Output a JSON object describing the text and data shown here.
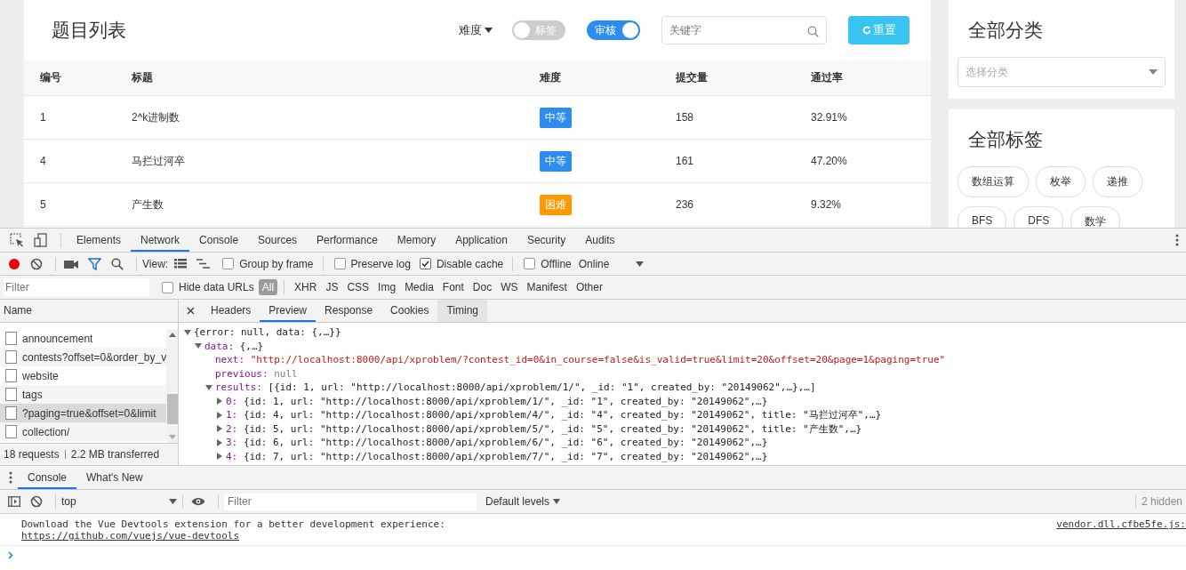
{
  "app": {
    "title": "题目列表",
    "difficulty_filter": "难度",
    "toggles": [
      {
        "label": "标签",
        "on": false
      },
      {
        "label": "审核",
        "on": true
      }
    ],
    "search": {
      "placeholder": "关键字"
    },
    "reset_button": "重置",
    "table": {
      "columns": [
        "编号",
        "标题",
        "难度",
        "提交量",
        "通过率"
      ],
      "rows": [
        {
          "id": "1",
          "title": "2^k进制数",
          "difficulty": "中等",
          "color": "#2d8cf0",
          "submissions": "158",
          "rate": "32.91%"
        },
        {
          "id": "4",
          "title": "马拦过河卒",
          "difficulty": "中等",
          "color": "#2d8cf0",
          "submissions": "161",
          "rate": "47.20%"
        },
        {
          "id": "5",
          "title": "产生数",
          "difficulty": "困难",
          "color": "#ff9900",
          "submissions": "236",
          "rate": "9.32%"
        }
      ]
    },
    "sidebar": {
      "category_title": "全部分类",
      "category_select": {
        "placeholder": "选择分类"
      },
      "tags_title": "全部标签",
      "tags": [
        "数组运算",
        "枚举",
        "递推",
        "BFS",
        "DFS",
        "数学"
      ]
    }
  },
  "devtools": {
    "tabs": [
      {
        "label": "Elements",
        "selected": false
      },
      {
        "label": "Network",
        "selected": true
      },
      {
        "label": "Console",
        "selected": false
      },
      {
        "label": "Sources",
        "selected": false
      },
      {
        "label": "Performance",
        "selected": false
      },
      {
        "label": "Memory",
        "selected": false
      },
      {
        "label": "Application",
        "selected": false
      },
      {
        "label": "Security",
        "selected": false
      },
      {
        "label": "Audits",
        "selected": false
      }
    ],
    "toolbar": {
      "view_label": "View:",
      "options": [
        {
          "label": "Group by frame",
          "checked": false
        },
        {
          "label": "Preserve log",
          "checked": false
        },
        {
          "label": "Disable cache",
          "checked": true
        },
        {
          "label": "Offline",
          "checked": false
        }
      ],
      "throttle": "Online"
    },
    "filter": {
      "placeholder": "Filter",
      "hide_data_urls": {
        "label": "Hide data URLs",
        "checked": false
      },
      "types": [
        {
          "label": "All",
          "selected": true
        },
        {
          "label": "XHR",
          "selected": false
        },
        {
          "label": "JS",
          "selected": false
        },
        {
          "label": "CSS",
          "selected": false
        },
        {
          "label": "Img",
          "selected": false
        },
        {
          "label": "Media",
          "selected": false
        },
        {
          "label": "Font",
          "selected": false
        },
        {
          "label": "Doc",
          "selected": false
        },
        {
          "label": "WS",
          "selected": false
        },
        {
          "label": "Manifest",
          "selected": false
        },
        {
          "label": "Other",
          "selected": false
        }
      ]
    },
    "requests": {
      "column": "Name",
      "items": [
        {
          "name": "announcement",
          "selected": false
        },
        {
          "name": "contests?offset=0&order_by_v",
          "selected": false
        },
        {
          "name": "website",
          "selected": false
        },
        {
          "name": "tags",
          "selected": false
        },
        {
          "name": "?paging=true&offset=0&limit",
          "selected": true
        },
        {
          "name": "collection/",
          "selected": false
        }
      ],
      "summary": [
        "18 requests",
        "2.2 MB transferred"
      ]
    },
    "detail_tabs": [
      {
        "label": "Headers",
        "selected": false
      },
      {
        "label": "Preview",
        "selected": true
      },
      {
        "label": "Response",
        "selected": false
      },
      {
        "label": "Cookies",
        "selected": false
      },
      {
        "label": "Timing",
        "selected": false
      }
    ],
    "preview": [
      {
        "value": "{error: null, data: {,…}}",
        "kind": "object",
        "expanded": true,
        "children": [
          {
            "key": "data:",
            "value": "{,…}",
            "kind": "object",
            "expanded": true,
            "children": [
              {
                "key": "next:",
                "value": "\"http://localhost:8000/api/xproblem/?contest_id=0&in_course=false&is_valid=true&limit=20&offset=20&page=1&paging=true\"",
                "kind": "string"
              },
              {
                "key": "previous:",
                "value": "null",
                "kind": "null"
              },
              {
                "key": "results:",
                "value": "[{id: 1, url: \"http://localhost:8000/api/xproblem/1/\", _id: \"1\", created_by: \"20149062\",…},…]",
                "kind": "object",
                "expanded": true,
                "children": [
                  {
                    "key": "0:",
                    "value": "{id: 1, url: \"http://localhost:8000/api/xproblem/1/\", _id: \"1\", created_by: \"20149062\",…}",
                    "kind": "object",
                    "expanded": false
                  },
                  {
                    "key": "1:",
                    "value": "{id: 4, url: \"http://localhost:8000/api/xproblem/4/\", _id: \"4\", created_by: \"20149062\", title: \"马拦过河卒\",…}",
                    "kind": "object",
                    "expanded": false
                  },
                  {
                    "key": "2:",
                    "value": "{id: 5, url: \"http://localhost:8000/api/xproblem/5/\", _id: \"5\", created_by: \"20149062\", title: \"产生数\",…}",
                    "kind": "object",
                    "expanded": false
                  },
                  {
                    "key": "3:",
                    "value": "{id: 6, url: \"http://localhost:8000/api/xproblem/6/\", _id: \"6\", created_by: \"20149062\",…}",
                    "kind": "object",
                    "expanded": false
                  },
                  {
                    "key": "4:",
                    "value": "{id: 7, url: \"http://localhost:8000/api/xproblem/7/\", _id: \"7\", created_by: \"20149062\",…}",
                    "kind": "object",
                    "expanded": false
                  }
                ]
              }
            ]
          }
        ]
      }
    ],
    "drawer": {
      "tabs": [
        {
          "label": "Console",
          "selected": true
        },
        {
          "label": "What's New",
          "selected": false
        }
      ],
      "context": "top",
      "filter_placeholder": "Filter",
      "levels": "Default levels",
      "hidden": "2 hidden",
      "messages": [
        {
          "text": "Download the Vue Devtools extension for a better development experience:",
          "link": "https://github.com/vuejs/vue-devtools",
          "source": "vendor.dll.cfbe5fe.js:"
        }
      ]
    }
  }
}
